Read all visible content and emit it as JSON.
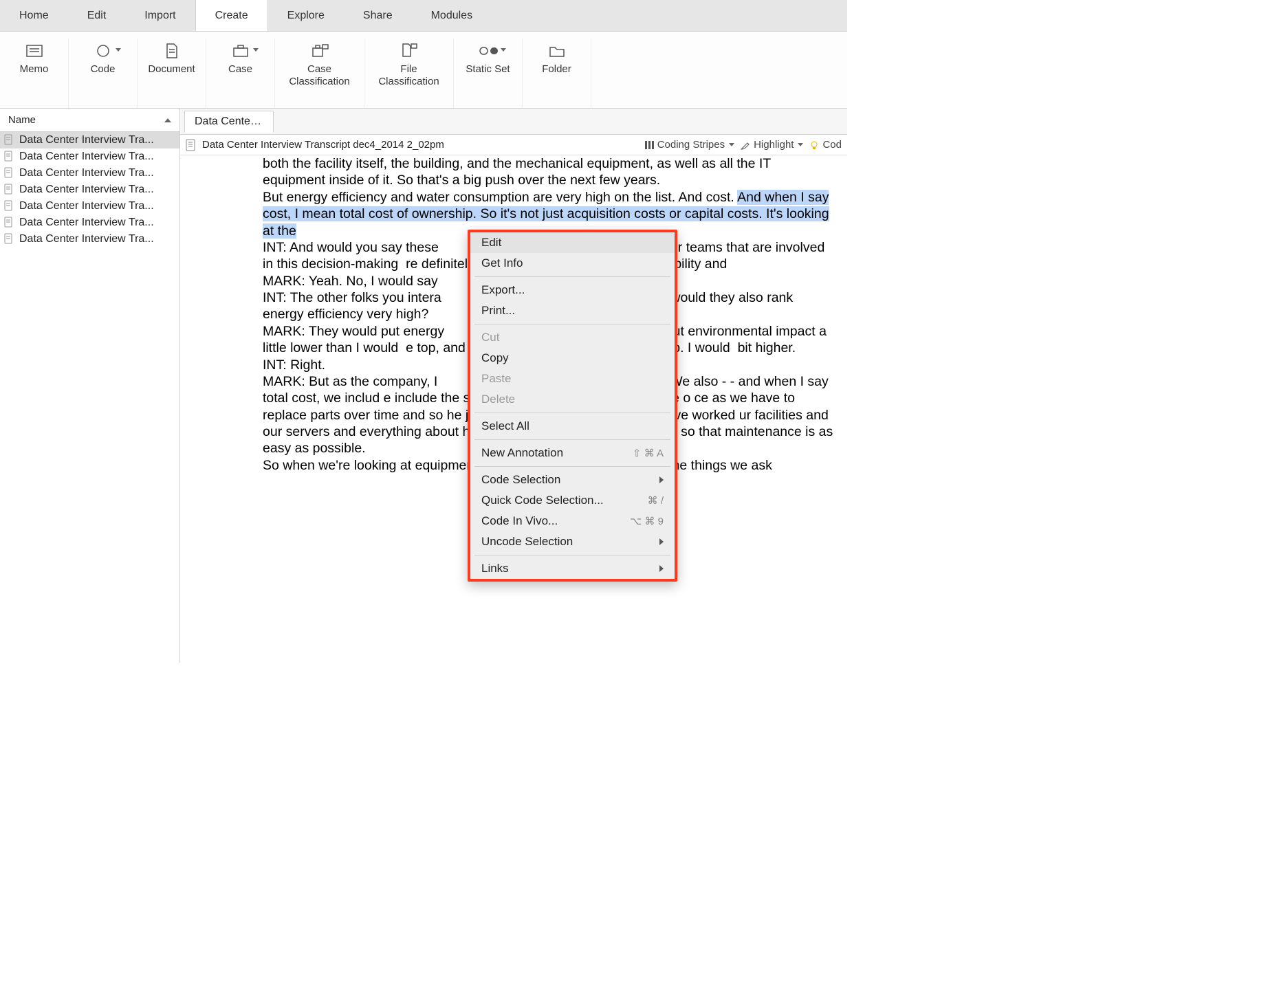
{
  "tabs": [
    "Home",
    "Edit",
    "Import",
    "Create",
    "Explore",
    "Share",
    "Modules"
  ],
  "active_tab": 3,
  "ribbon": [
    {
      "label": "Memo",
      "icon": "memo"
    },
    {
      "label": "Code",
      "icon": "code",
      "dd": true
    },
    {
      "label": "Document",
      "icon": "document"
    },
    {
      "label": "Case",
      "icon": "case",
      "dd": true
    },
    {
      "label": "Case\nClassification",
      "icon": "case-class"
    },
    {
      "label": "File\nClassification",
      "icon": "file-class"
    },
    {
      "label": "Static Set",
      "icon": "static-set",
      "dd": true
    },
    {
      "label": "Folder",
      "icon": "folder"
    }
  ],
  "sidebar": {
    "header": "Name",
    "items": [
      "Data Center Interview Tra...",
      "Data Center Interview Tra...",
      "Data Center Interview Tra...",
      "Data Center Interview Tra...",
      "Data Center Interview Tra...",
      "Data Center Interview Tra...",
      "Data Center Interview Tra..."
    ],
    "selected": 0
  },
  "doc": {
    "tab_label": "Data Center I...",
    "title": "Data Center Interview Transcript dec4_2014 2_02pm",
    "strip": {
      "coding_stripes": "Coding Stripes",
      "highlight": "Highlight",
      "code_trunc": "Cod"
    },
    "paragraphs": [
      {
        "pre": "",
        "text": "both the facility itself, the building, and the mechanical equipment, as well as all the IT equipment inside of it.  So that's a big push over the next few years."
      },
      {
        "pre": "But energy efficiency and water consumption are very high on the list.  And cost.  ",
        "hl": "And when I say cost, I mean total cost of ownership.  So it's not just acquisition costs or capital costs.  It's looking at the"
      },
      {
        "pre": "INT:  And would you say these",
        "post": "ther teams that are involved in this decision-making",
        "post2": "re definitely the top for your team on sustainability and"
      },
      {
        "pre": "MARK:  Yeah.  No, I would say"
      },
      {
        "pre": "INT:  The other folks you intera",
        "post": "or would they also rank energy efficiency very high?"
      },
      {
        "pre": "MARK:  They would put energy",
        "mid": "t put environmental impact a little lower than I would",
        "post": "e top, and they agree it should be near the top.  I would",
        "post2": "bit higher."
      },
      {
        "pre": "INT:  Right."
      },
      {
        "pre": "MARK:  But as the company, I",
        "a": "rs.  We also - - and when I say total cost, we includ",
        "b": "e include the sort of obvious operational costs like o",
        "c": "ce as we have to replace parts over time and so",
        "d": "he job of actually running a facility, we've worked",
        "e": "ur facilities and our servers and everything about how we put the whole thing together so that maintenance is as easy as possible."
      },
      {
        "pre": "So when we're looking at equipment that we might purchase, one of the things we ask"
      }
    ]
  },
  "context_menu": [
    {
      "label": "Edit",
      "hover": true
    },
    {
      "label": "Get Info"
    },
    {
      "sep": true
    },
    {
      "label": "Export..."
    },
    {
      "label": "Print..."
    },
    {
      "sep": true
    },
    {
      "label": "Cut",
      "disabled": true
    },
    {
      "label": "Copy"
    },
    {
      "label": "Paste",
      "disabled": true
    },
    {
      "label": "Delete",
      "disabled": true
    },
    {
      "sep": true
    },
    {
      "label": "Select All"
    },
    {
      "sep": true
    },
    {
      "label": "New Annotation",
      "shortcut": "⇧ ⌘ A"
    },
    {
      "sep": true
    },
    {
      "label": "Code Selection",
      "submenu": true
    },
    {
      "label": "Quick Code Selection...",
      "shortcut": "⌘ /"
    },
    {
      "label": "Code In Vivo...",
      "shortcut": "⌥ ⌘ 9"
    },
    {
      "label": "Uncode Selection",
      "submenu": true
    },
    {
      "sep": true
    },
    {
      "label": "Links",
      "submenu": true
    }
  ]
}
